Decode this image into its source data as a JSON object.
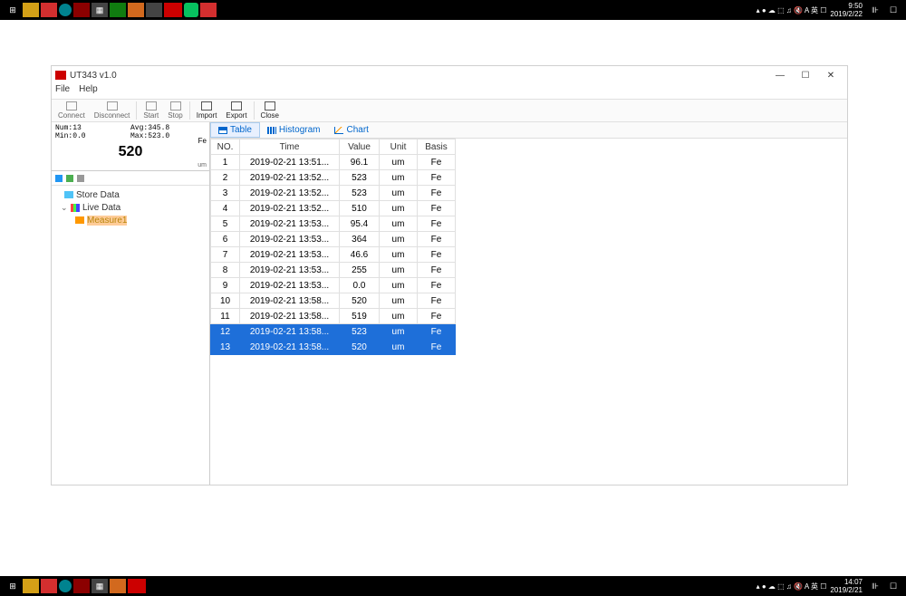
{
  "taskbar_top": {
    "time": "9:50",
    "date": "2019/2/22"
  },
  "taskbar_bottom": {
    "time": "14:07",
    "date": "2019/2/21"
  },
  "window": {
    "title": "UT343 v1.0",
    "menu": {
      "file": "File",
      "help": "Help"
    },
    "controls": {
      "min": "—",
      "max": "☐",
      "close": "✕"
    }
  },
  "toolbar": {
    "connect": "Connect",
    "disconnect": "Disconnect",
    "start": "Start",
    "stop": "Stop",
    "import": "Import",
    "export": "Export",
    "close": "Close"
  },
  "stats": {
    "num": "Num:13",
    "avg": "Avg:345.8",
    "min": "Min:0.0",
    "max": "Max:523.0",
    "big": "520",
    "fe": "Fe",
    "um": "um"
  },
  "tree": {
    "store": "Store Data",
    "live": "Live Data",
    "measure1": "Measure1"
  },
  "tabs": {
    "table": "Table",
    "histogram": "Histogram",
    "chart": "Chart"
  },
  "table": {
    "headers": {
      "no": "NO.",
      "time": "Time",
      "value": "Value",
      "unit": "Unit",
      "basis": "Basis"
    },
    "rows": [
      {
        "no": "1",
        "time": "2019-02-21 13:51...",
        "value": "96.1",
        "unit": "um",
        "basis": "Fe",
        "selected": false
      },
      {
        "no": "2",
        "time": "2019-02-21 13:52...",
        "value": "523",
        "unit": "um",
        "basis": "Fe",
        "selected": false
      },
      {
        "no": "3",
        "time": "2019-02-21 13:52...",
        "value": "523",
        "unit": "um",
        "basis": "Fe",
        "selected": false
      },
      {
        "no": "4",
        "time": "2019-02-21 13:52...",
        "value": "510",
        "unit": "um",
        "basis": "Fe",
        "selected": false
      },
      {
        "no": "5",
        "time": "2019-02-21 13:53...",
        "value": "95.4",
        "unit": "um",
        "basis": "Fe",
        "selected": false
      },
      {
        "no": "6",
        "time": "2019-02-21 13:53...",
        "value": "364",
        "unit": "um",
        "basis": "Fe",
        "selected": false
      },
      {
        "no": "7",
        "time": "2019-02-21 13:53...",
        "value": "46.6",
        "unit": "um",
        "basis": "Fe",
        "selected": false
      },
      {
        "no": "8",
        "time": "2019-02-21 13:53...",
        "value": "255",
        "unit": "um",
        "basis": "Fe",
        "selected": false
      },
      {
        "no": "9",
        "time": "2019-02-21 13:53...",
        "value": "0.0",
        "unit": "um",
        "basis": "Fe",
        "selected": false
      },
      {
        "no": "10",
        "time": "2019-02-21 13:58...",
        "value": "520",
        "unit": "um",
        "basis": "Fe",
        "selected": false
      },
      {
        "no": "11",
        "time": "2019-02-21 13:58...",
        "value": "519",
        "unit": "um",
        "basis": "Fe",
        "selected": false
      },
      {
        "no": "12",
        "time": "2019-02-21 13:58...",
        "value": "523",
        "unit": "um",
        "basis": "Fe",
        "selected": true
      },
      {
        "no": "13",
        "time": "2019-02-21 13:58...",
        "value": "520",
        "unit": "um",
        "basis": "Fe",
        "selected": true
      }
    ]
  }
}
